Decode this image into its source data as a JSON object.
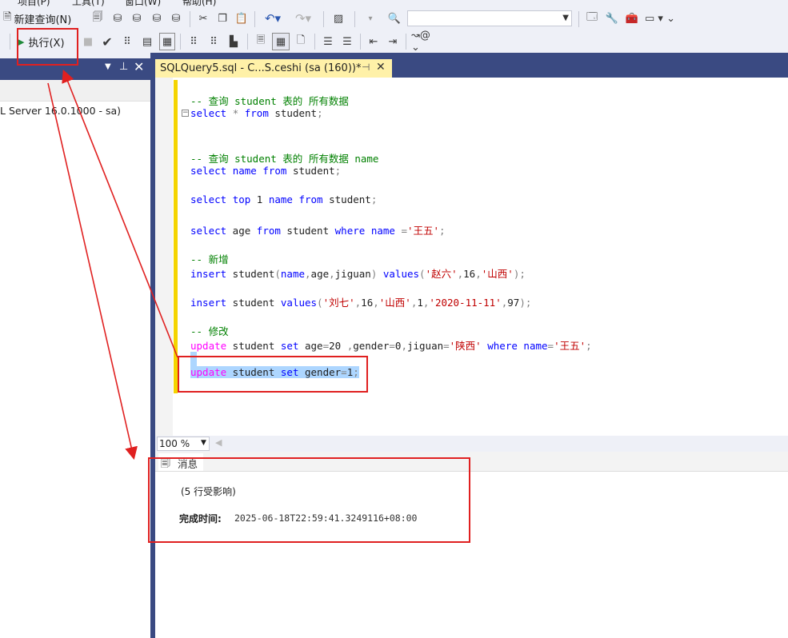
{
  "menubar": {
    "items": [
      "项目(P)",
      "工具(T)",
      "窗口(W)",
      "帮助(H)"
    ]
  },
  "toolbar1": {
    "new_query_label": "新建查询(N)",
    "db_combo_value": ""
  },
  "toolbar2": {
    "execute_label": "执行(X)"
  },
  "object_explorer": {
    "server_node": "L Server 16.0.1000 - sa)"
  },
  "editor_tab": {
    "title": "SQLQuery5.sql - C...S.ceshi (sa (160))*"
  },
  "zoom": {
    "value": "100 %"
  },
  "results": {
    "messages_tab_label": "消息",
    "rows_affected": "(5 行受影响)",
    "completion_label": "完成时间:",
    "completion_time": "2025-06-18T22:59:41.3249116+08:00"
  },
  "colors": {
    "accent": "#3a4a82",
    "tab_active": "#fff1a8",
    "highlight": "#e02020"
  }
}
